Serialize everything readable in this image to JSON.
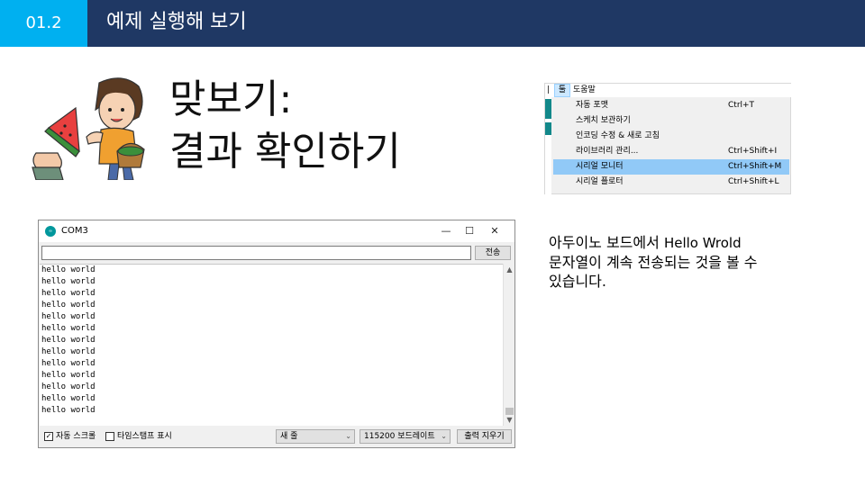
{
  "header": {
    "section_number": "01.2",
    "title": "예제 실행해 보기"
  },
  "slide": {
    "title_line1": "맞보기:",
    "title_line2": "결과 확인하기"
  },
  "menu": {
    "separator": "|",
    "tools_label": "툴",
    "help_label": "도움말",
    "items": [
      {
        "label": "자동 포맷",
        "shortcut": "Ctrl+T"
      },
      {
        "label": "스케치 보관하기",
        "shortcut": ""
      },
      {
        "label": "인코딩 수정 & 새로 고침",
        "shortcut": ""
      },
      {
        "label": "라이브러리 관리...",
        "shortcut": "Ctrl+Shift+I"
      },
      {
        "label": "시리얼 모니터",
        "shortcut": "Ctrl+Shift+M",
        "highlighted": true
      },
      {
        "label": "시리얼 플로터",
        "shortcut": "Ctrl+Shift+L"
      }
    ],
    "highlight_color": "#91c9f7"
  },
  "description": {
    "line1_ko": "아두이노 보드에서 ",
    "line1_en": "Hello Wrold",
    "line2": "문자열이 계속 전송되는 것을 볼 수",
    "line3": "있습니다."
  },
  "serial_monitor": {
    "window_title": "COM3",
    "logo_text": "∞",
    "input_value": "",
    "send_button": "전송",
    "output_lines": [
      "hello world",
      "hello world",
      "hello world",
      "hello world",
      "hello world",
      "hello world",
      "hello world",
      "hello world",
      "hello world",
      "hello world",
      "hello world",
      "hello world",
      "hello world"
    ],
    "autoscroll_label": "자동 스크롤",
    "autoscroll_checked": true,
    "timestamp_label": "타임스탬프 표시",
    "timestamp_checked": false,
    "line_ending": "새 줄",
    "baud_rate": "115200 보드레이트",
    "clear_button": "출력 지우기"
  },
  "colors": {
    "header_bg": "#1f3864",
    "section_bg": "#00b0f0",
    "arduino_teal": "#00979c"
  }
}
